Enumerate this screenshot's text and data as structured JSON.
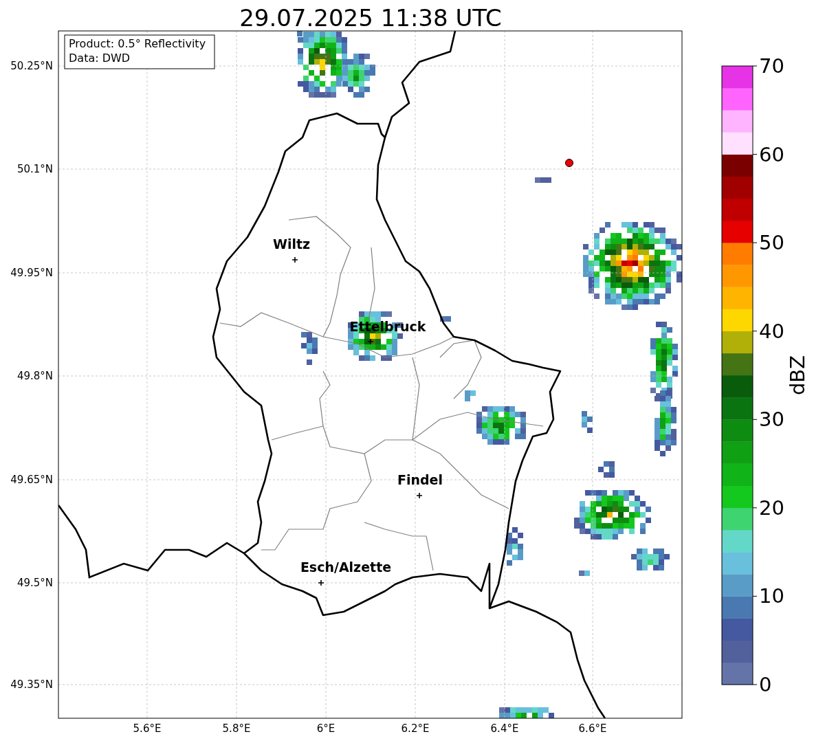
{
  "title": "29.07.2025 11:38 UTC",
  "info_box": [
    "Product: 0.5° Reflectivity",
    "Data: DWD"
  ],
  "x_ticks": [
    "5.6°E",
    "5.8°E",
    "6°E",
    "6.2°E",
    "6.4°E",
    "6.6°E"
  ],
  "y_ticks": [
    "50.25°N",
    "50.1°N",
    "49.95°N",
    "49.8°N",
    "49.65°N",
    "49.5°N",
    "49.35°N"
  ],
  "cities": [
    {
      "name": "Wiltz"
    },
    {
      "name": "Ettelbruck"
    },
    {
      "name": "Findel"
    },
    {
      "name": "Esch/Alzette"
    }
  ],
  "colorbar": {
    "label": "dBZ",
    "ticks": [
      "70",
      "60",
      "50",
      "40",
      "30",
      "20",
      "10",
      "0"
    ],
    "bands": [
      {
        "color": "#6474a8"
      },
      {
        "color": "#52609c"
      },
      {
        "color": "#4459a0"
      },
      {
        "color": "#4a78b0"
      },
      {
        "color": "#5a9cc8"
      },
      {
        "color": "#68c0dc"
      },
      {
        "color": "#64d8c8"
      },
      {
        "color": "#3ed470"
      },
      {
        "color": "#14c81e"
      },
      {
        "color": "#10b418"
      },
      {
        "color": "#0fa014"
      },
      {
        "color": "#0e8c12"
      },
      {
        "color": "#0a7410"
      },
      {
        "color": "#085c0c"
      },
      {
        "color": "#447414"
      },
      {
        "color": "#b0b008"
      },
      {
        "color": "#ffd700"
      },
      {
        "color": "#ffb400"
      },
      {
        "color": "#ff9800"
      },
      {
        "color": "#ff7c00"
      },
      {
        "color": "#e60000"
      },
      {
        "color": "#c00000"
      },
      {
        "color": "#a00000"
      },
      {
        "color": "#7a0000"
      },
      {
        "color": "#ffe0ff"
      },
      {
        "color": "#ffb4ff"
      },
      {
        "color": "#ff64ff"
      },
      {
        "color": "#e633e6"
      }
    ]
  }
}
